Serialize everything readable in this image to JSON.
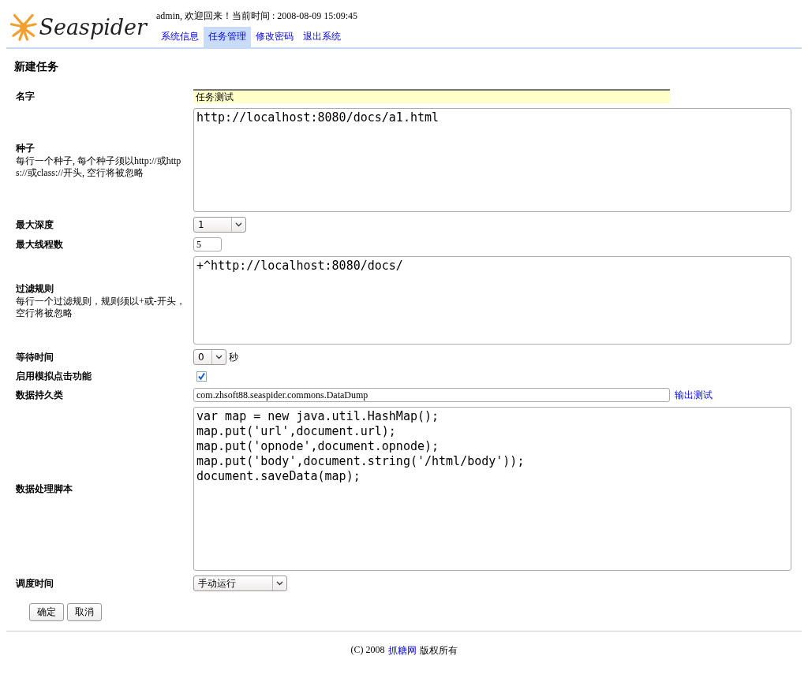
{
  "header": {
    "logo": "Seaspider",
    "welcome": "admin, 欢迎回来！当前时间 : 2008-08-09 15:09:45",
    "nav": [
      {
        "label": "系统信息",
        "selected": false
      },
      {
        "label": "任务管理",
        "selected": true
      },
      {
        "label": "修改密码",
        "selected": false
      },
      {
        "label": "退出系统",
        "selected": false
      }
    ]
  },
  "page_title": "新建任务",
  "fields": [
    {
      "kind": "text",
      "label": "名字",
      "value": "任务测试",
      "highlighted": true
    },
    {
      "kind": "textarea",
      "label": "种子",
      "hint": "每行一个种子, 每个种子须以http://或https://或class://开头, 空行将被忽略",
      "value": "http://localhost:8080/docs/a1.html"
    },
    {
      "kind": "select",
      "label": "最大深度",
      "value": "1"
    },
    {
      "kind": "number",
      "label": "最大线程数",
      "value": "5"
    },
    {
      "kind": "textarea",
      "label": "过滤规则",
      "hint": "每行一个过滤规则，规则须以+或-开头，空行将被忽略",
      "value": "+^http://localhost:8080/docs/"
    },
    {
      "kind": "select",
      "label": "等待时间",
      "value": "0",
      "suffix": "秒"
    },
    {
      "kind": "checkbox",
      "label": "启用模拟点击功能",
      "checked": true
    },
    {
      "kind": "text",
      "label": "数据持久类",
      "value": "com.zhsoft88.seaspider.commons.DataDump",
      "highlighted": false,
      "link": "输出测试"
    },
    {
      "kind": "textarea",
      "label": "数据处理脚本",
      "value": "var map = new java.util.HashMap();\nmap.put('url',document.url);\nmap.put('opnode',document.opnode);\nmap.put('body',document.string('/html/body'));\ndocument.saveData(map);"
    },
    {
      "kind": "select",
      "label": "调度时间",
      "value": "手动运行"
    }
  ],
  "buttons": [
    "确定",
    "取消"
  ],
  "footer": {
    "before": "(C) 2008",
    "link": "抓糖网",
    "after": "版权所有"
  }
}
